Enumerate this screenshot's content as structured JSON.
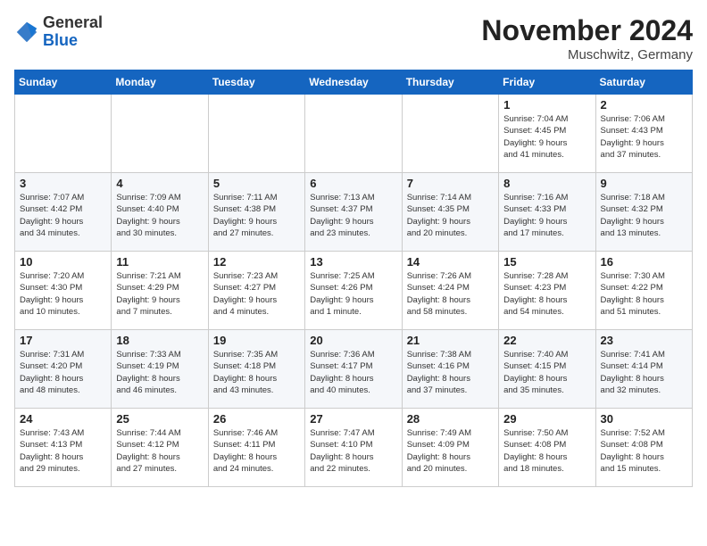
{
  "header": {
    "logo_general": "General",
    "logo_blue": "Blue",
    "month_title": "November 2024",
    "location": "Muschwitz, Germany"
  },
  "weekdays": [
    "Sunday",
    "Monday",
    "Tuesday",
    "Wednesday",
    "Thursday",
    "Friday",
    "Saturday"
  ],
  "weeks": [
    [
      {
        "day": "",
        "info": ""
      },
      {
        "day": "",
        "info": ""
      },
      {
        "day": "",
        "info": ""
      },
      {
        "day": "",
        "info": ""
      },
      {
        "day": "",
        "info": ""
      },
      {
        "day": "1",
        "info": "Sunrise: 7:04 AM\nSunset: 4:45 PM\nDaylight: 9 hours\nand 41 minutes."
      },
      {
        "day": "2",
        "info": "Sunrise: 7:06 AM\nSunset: 4:43 PM\nDaylight: 9 hours\nand 37 minutes."
      }
    ],
    [
      {
        "day": "3",
        "info": "Sunrise: 7:07 AM\nSunset: 4:42 PM\nDaylight: 9 hours\nand 34 minutes."
      },
      {
        "day": "4",
        "info": "Sunrise: 7:09 AM\nSunset: 4:40 PM\nDaylight: 9 hours\nand 30 minutes."
      },
      {
        "day": "5",
        "info": "Sunrise: 7:11 AM\nSunset: 4:38 PM\nDaylight: 9 hours\nand 27 minutes."
      },
      {
        "day": "6",
        "info": "Sunrise: 7:13 AM\nSunset: 4:37 PM\nDaylight: 9 hours\nand 23 minutes."
      },
      {
        "day": "7",
        "info": "Sunrise: 7:14 AM\nSunset: 4:35 PM\nDaylight: 9 hours\nand 20 minutes."
      },
      {
        "day": "8",
        "info": "Sunrise: 7:16 AM\nSunset: 4:33 PM\nDaylight: 9 hours\nand 17 minutes."
      },
      {
        "day": "9",
        "info": "Sunrise: 7:18 AM\nSunset: 4:32 PM\nDaylight: 9 hours\nand 13 minutes."
      }
    ],
    [
      {
        "day": "10",
        "info": "Sunrise: 7:20 AM\nSunset: 4:30 PM\nDaylight: 9 hours\nand 10 minutes."
      },
      {
        "day": "11",
        "info": "Sunrise: 7:21 AM\nSunset: 4:29 PM\nDaylight: 9 hours\nand 7 minutes."
      },
      {
        "day": "12",
        "info": "Sunrise: 7:23 AM\nSunset: 4:27 PM\nDaylight: 9 hours\nand 4 minutes."
      },
      {
        "day": "13",
        "info": "Sunrise: 7:25 AM\nSunset: 4:26 PM\nDaylight: 9 hours\nand 1 minute."
      },
      {
        "day": "14",
        "info": "Sunrise: 7:26 AM\nSunset: 4:24 PM\nDaylight: 8 hours\nand 58 minutes."
      },
      {
        "day": "15",
        "info": "Sunrise: 7:28 AM\nSunset: 4:23 PM\nDaylight: 8 hours\nand 54 minutes."
      },
      {
        "day": "16",
        "info": "Sunrise: 7:30 AM\nSunset: 4:22 PM\nDaylight: 8 hours\nand 51 minutes."
      }
    ],
    [
      {
        "day": "17",
        "info": "Sunrise: 7:31 AM\nSunset: 4:20 PM\nDaylight: 8 hours\nand 48 minutes."
      },
      {
        "day": "18",
        "info": "Sunrise: 7:33 AM\nSunset: 4:19 PM\nDaylight: 8 hours\nand 46 minutes."
      },
      {
        "day": "19",
        "info": "Sunrise: 7:35 AM\nSunset: 4:18 PM\nDaylight: 8 hours\nand 43 minutes."
      },
      {
        "day": "20",
        "info": "Sunrise: 7:36 AM\nSunset: 4:17 PM\nDaylight: 8 hours\nand 40 minutes."
      },
      {
        "day": "21",
        "info": "Sunrise: 7:38 AM\nSunset: 4:16 PM\nDaylight: 8 hours\nand 37 minutes."
      },
      {
        "day": "22",
        "info": "Sunrise: 7:40 AM\nSunset: 4:15 PM\nDaylight: 8 hours\nand 35 minutes."
      },
      {
        "day": "23",
        "info": "Sunrise: 7:41 AM\nSunset: 4:14 PM\nDaylight: 8 hours\nand 32 minutes."
      }
    ],
    [
      {
        "day": "24",
        "info": "Sunrise: 7:43 AM\nSunset: 4:13 PM\nDaylight: 8 hours\nand 29 minutes."
      },
      {
        "day": "25",
        "info": "Sunrise: 7:44 AM\nSunset: 4:12 PM\nDaylight: 8 hours\nand 27 minutes."
      },
      {
        "day": "26",
        "info": "Sunrise: 7:46 AM\nSunset: 4:11 PM\nDaylight: 8 hours\nand 24 minutes."
      },
      {
        "day": "27",
        "info": "Sunrise: 7:47 AM\nSunset: 4:10 PM\nDaylight: 8 hours\nand 22 minutes."
      },
      {
        "day": "28",
        "info": "Sunrise: 7:49 AM\nSunset: 4:09 PM\nDaylight: 8 hours\nand 20 minutes."
      },
      {
        "day": "29",
        "info": "Sunrise: 7:50 AM\nSunset: 4:08 PM\nDaylight: 8 hours\nand 18 minutes."
      },
      {
        "day": "30",
        "info": "Sunrise: 7:52 AM\nSunset: 4:08 PM\nDaylight: 8 hours\nand 15 minutes."
      }
    ]
  ]
}
